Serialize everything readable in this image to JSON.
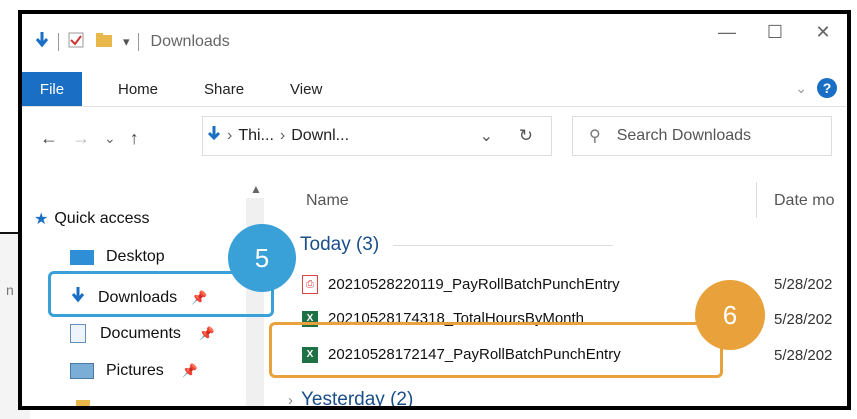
{
  "window": {
    "title": "Downloads",
    "controls": {
      "minimize": "—",
      "maximize": "☐",
      "close": "✕"
    }
  },
  "ribbon": {
    "tabs": [
      "File",
      "Home",
      "Share",
      "View"
    ],
    "help": "?"
  },
  "navigation": {
    "back": "←",
    "forward": "→",
    "recent": "⌄",
    "up": "↑",
    "path": [
      "Thi...",
      "Downl..."
    ],
    "dropdown": "⌄",
    "refresh": "↻",
    "search_placeholder": "Search Downloads"
  },
  "nav_pane": {
    "quick_access": "Quick access",
    "items": [
      {
        "label": "Desktop"
      },
      {
        "label": "Downloads"
      },
      {
        "label": "Documents"
      },
      {
        "label": "Pictures"
      }
    ]
  },
  "file_list": {
    "columns": {
      "name": "Name",
      "date": "Date mo"
    },
    "groups": [
      {
        "label": "Today (3)"
      },
      {
        "label": "Yesterday (2)"
      }
    ],
    "files": [
      {
        "name": "20210528220119_PayRollBatchPunchEntry",
        "date": "5/28/202",
        "type": "pdf"
      },
      {
        "name": "20210528174318_TotalHoursByMonth",
        "date": "5/28/202",
        "type": "excel"
      },
      {
        "name": "20210528172147_PayRollBatchPunchEntry",
        "date": "5/28/202",
        "type": "excel"
      }
    ]
  },
  "callouts": [
    {
      "number": "5",
      "color": "#3aa0d8"
    },
    {
      "number": "6",
      "color": "#e9a23b"
    }
  ],
  "background": {
    "edge_text": "n"
  }
}
